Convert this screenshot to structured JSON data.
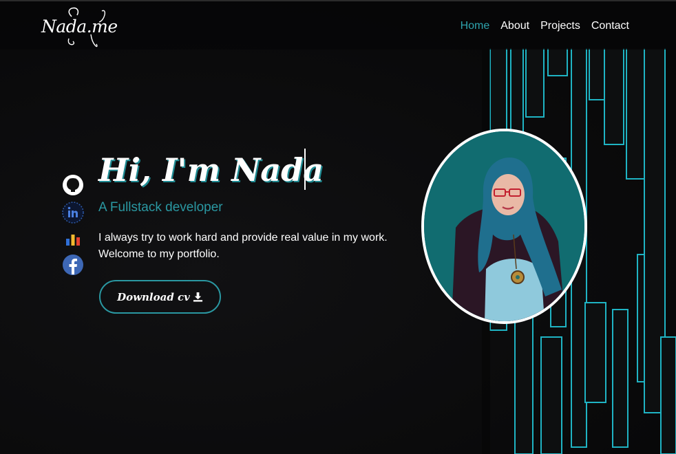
{
  "brand": {
    "logo_text": "Nada.me"
  },
  "nav": {
    "items": [
      {
        "label": "Home",
        "active": true
      },
      {
        "label": "About",
        "active": false
      },
      {
        "label": "Projects",
        "active": false
      },
      {
        "label": "Contact",
        "active": false
      }
    ]
  },
  "social": {
    "icons": [
      "github-icon",
      "linkedin-icon",
      "stats-icon",
      "facebook-icon"
    ]
  },
  "hero": {
    "title": "Hi, I'm Nada",
    "subtitle": "A Fullstack developer",
    "description_line1": "I always try to work hard and provide real value in my work.",
    "description_line2": "Welcome to my portfolio.",
    "button_label": "Download cv"
  },
  "colors": {
    "accent": "#2a98a2",
    "background": "#0a0a0b",
    "active_nav": "#2ea3ad",
    "photo_background": "#116c70"
  }
}
